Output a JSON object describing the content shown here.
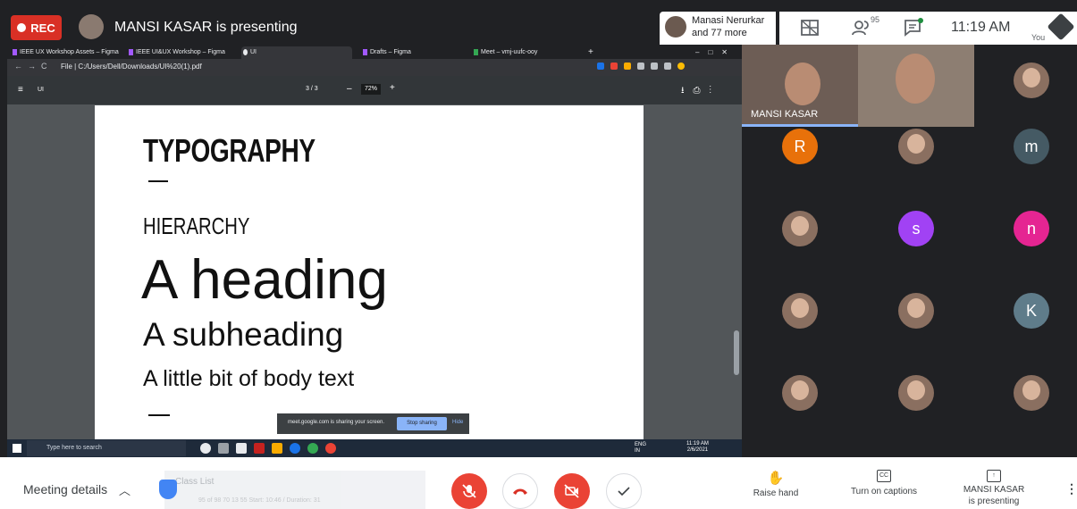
{
  "topbar": {
    "rec_label": "REC",
    "presenting_title": "MANSI KASAR is presenting",
    "participant_summary_line1": "Manasi Nerurkar",
    "participant_summary_line2": "and 77 more",
    "people_count": "95",
    "time": "11:19 AM",
    "you_label": "You"
  },
  "browser": {
    "tabs": [
      "IEEE UX Workshop Assets – Figma",
      "IEEE UI&UX Workshop – Figma",
      "UI",
      "Drafts – Figma",
      "Meet – vmj-uufc-ooy"
    ],
    "url": "File  |  C:/Users/Dell/Downloads/UI%20(1).pdf",
    "pdf_name": "UI",
    "page_indicator": "3  /  3",
    "zoom": "72%"
  },
  "pdf_page": {
    "title": "TYPOGRAPHY",
    "section": "HIERARCHY",
    "heading": "A heading",
    "subheading": "A subheading",
    "body": "A little bit of body text"
  },
  "share_notice": {
    "text": "meet.google.com is sharing your screen.",
    "stop_label": "Stop sharing",
    "hide_label": "Hide"
  },
  "taskbar": {
    "search_placeholder": "Type here to search",
    "lang": "ENG",
    "region": "IN",
    "clock_time": "11:19 AM",
    "clock_date": "2/6/2021"
  },
  "participants": {
    "speaker_name": "MANSI KASAR",
    "tiles": [
      {
        "kind": "photo"
      },
      {
        "kind": "letter",
        "letter": "R",
        "color": "#e8710a"
      },
      {
        "kind": "photo"
      },
      {
        "kind": "letter",
        "letter": "m",
        "color": "#455a64"
      },
      {
        "kind": "photo"
      },
      {
        "kind": "letter",
        "letter": "s",
        "color": "#a142f4"
      },
      {
        "kind": "letter",
        "letter": "n",
        "color": "#e52592"
      },
      {
        "kind": "photo"
      },
      {
        "kind": "photo"
      },
      {
        "kind": "letter",
        "letter": "K",
        "color": "#5f7c8a"
      },
      {
        "kind": "photo"
      },
      {
        "kind": "photo"
      },
      {
        "kind": "photo"
      }
    ]
  },
  "bottombar": {
    "meeting_details": "Meeting details",
    "class_list_ghost": "Class List",
    "ghost_stats": "95 of 98   70   13   55   Start: 10:46 / Duration: 31",
    "raise_hand": "Raise hand",
    "captions": "Turn on captions",
    "presenting_line1": "MANSI KASAR",
    "presenting_line2": "is presenting"
  },
  "colors": {
    "rec_red": "#d93025",
    "end_call_red": "#ea4335",
    "speaker_highlight": "#8ab4f8",
    "dark_bg": "#202124"
  }
}
